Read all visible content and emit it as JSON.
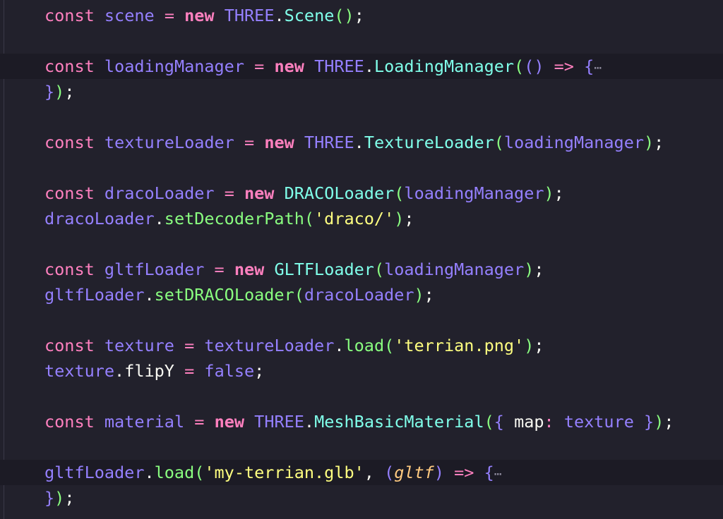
{
  "lines": [
    {
      "tokens": [
        {
          "t": "const",
          "c": "kw"
        },
        {
          "t": " "
        },
        {
          "t": "scene",
          "c": "var"
        },
        {
          "t": " "
        },
        {
          "t": "=",
          "c": "op"
        },
        {
          "t": " "
        },
        {
          "t": "new",
          "c": "new"
        },
        {
          "t": " "
        },
        {
          "t": "THREE",
          "c": "ns"
        },
        {
          "t": ".",
          "c": "plain"
        },
        {
          "t": "Scene",
          "c": "cls"
        },
        {
          "t": "()",
          "c": "brc"
        },
        {
          "t": ";",
          "c": "plain"
        }
      ]
    },
    {
      "tokens": []
    },
    {
      "highlight": true,
      "tokens": [
        {
          "t": "const",
          "c": "kw"
        },
        {
          "t": " "
        },
        {
          "t": "loadingManager",
          "c": "var"
        },
        {
          "t": " "
        },
        {
          "t": "=",
          "c": "op"
        },
        {
          "t": " "
        },
        {
          "t": "new",
          "c": "new"
        },
        {
          "t": " "
        },
        {
          "t": "THREE",
          "c": "ns"
        },
        {
          "t": ".",
          "c": "plain"
        },
        {
          "t": "LoadingManager",
          "c": "cls"
        },
        {
          "t": "(",
          "c": "brc"
        },
        {
          "t": "()",
          "c": "var"
        },
        {
          "t": " "
        },
        {
          "t": "=>",
          "c": "op"
        },
        {
          "t": " "
        },
        {
          "t": "{",
          "c": "var"
        },
        {
          "t": "⋯",
          "c": "fold"
        }
      ]
    },
    {
      "tokens": [
        {
          "t": "}",
          "c": "var"
        },
        {
          "t": ")",
          "c": "brc"
        },
        {
          "t": ";",
          "c": "plain"
        }
      ]
    },
    {
      "tokens": []
    },
    {
      "tokens": [
        {
          "t": "const",
          "c": "kw"
        },
        {
          "t": " "
        },
        {
          "t": "textureLoader",
          "c": "var"
        },
        {
          "t": " "
        },
        {
          "t": "=",
          "c": "op"
        },
        {
          "t": " "
        },
        {
          "t": "new",
          "c": "new"
        },
        {
          "t": " "
        },
        {
          "t": "THREE",
          "c": "ns"
        },
        {
          "t": ".",
          "c": "plain"
        },
        {
          "t": "TextureLoader",
          "c": "cls"
        },
        {
          "t": "(",
          "c": "brc"
        },
        {
          "t": "loadingManager",
          "c": "var"
        },
        {
          "t": ")",
          "c": "brc"
        },
        {
          "t": ";",
          "c": "plain"
        }
      ]
    },
    {
      "tokens": []
    },
    {
      "tokens": [
        {
          "t": "const",
          "c": "kw"
        },
        {
          "t": " "
        },
        {
          "t": "dracoLoader",
          "c": "var"
        },
        {
          "t": " "
        },
        {
          "t": "=",
          "c": "op"
        },
        {
          "t": " "
        },
        {
          "t": "new",
          "c": "new"
        },
        {
          "t": " "
        },
        {
          "t": "DRACOLoader",
          "c": "cls"
        },
        {
          "t": "(",
          "c": "brc"
        },
        {
          "t": "loadingManager",
          "c": "var"
        },
        {
          "t": ")",
          "c": "brc"
        },
        {
          "t": ";",
          "c": "plain"
        }
      ]
    },
    {
      "tokens": [
        {
          "t": "dracoLoader",
          "c": "var"
        },
        {
          "t": ".",
          "c": "plain"
        },
        {
          "t": "setDecoderPath",
          "c": "fn"
        },
        {
          "t": "(",
          "c": "brc"
        },
        {
          "t": "'draco/'",
          "c": "str"
        },
        {
          "t": ")",
          "c": "brc"
        },
        {
          "t": ";",
          "c": "plain"
        }
      ]
    },
    {
      "tokens": []
    },
    {
      "tokens": [
        {
          "t": "const",
          "c": "kw"
        },
        {
          "t": " "
        },
        {
          "t": "gltfLoader",
          "c": "var"
        },
        {
          "t": " "
        },
        {
          "t": "=",
          "c": "op"
        },
        {
          "t": " "
        },
        {
          "t": "new",
          "c": "new"
        },
        {
          "t": " "
        },
        {
          "t": "GLTFLoader",
          "c": "cls"
        },
        {
          "t": "(",
          "c": "brc"
        },
        {
          "t": "loadingManager",
          "c": "var"
        },
        {
          "t": ")",
          "c": "brc"
        },
        {
          "t": ";",
          "c": "plain"
        }
      ]
    },
    {
      "tokens": [
        {
          "t": "gltfLoader",
          "c": "var"
        },
        {
          "t": ".",
          "c": "plain"
        },
        {
          "t": "setDRACOLoader",
          "c": "fn"
        },
        {
          "t": "(",
          "c": "brc"
        },
        {
          "t": "dracoLoader",
          "c": "var"
        },
        {
          "t": ")",
          "c": "brc"
        },
        {
          "t": ";",
          "c": "plain"
        }
      ]
    },
    {
      "tokens": []
    },
    {
      "tokens": [
        {
          "t": "const",
          "c": "kw"
        },
        {
          "t": " "
        },
        {
          "t": "texture",
          "c": "var"
        },
        {
          "t": " "
        },
        {
          "t": "=",
          "c": "op"
        },
        {
          "t": " "
        },
        {
          "t": "textureLoader",
          "c": "var"
        },
        {
          "t": ".",
          "c": "plain"
        },
        {
          "t": "load",
          "c": "fn"
        },
        {
          "t": "(",
          "c": "brc"
        },
        {
          "t": "'terrian.png'",
          "c": "str"
        },
        {
          "t": ")",
          "c": "brc"
        },
        {
          "t": ";",
          "c": "plain"
        }
      ]
    },
    {
      "tokens": [
        {
          "t": "texture",
          "c": "var"
        },
        {
          "t": ".",
          "c": "plain"
        },
        {
          "t": "flipY",
          "c": "plain"
        },
        {
          "t": " "
        },
        {
          "t": "=",
          "c": "op"
        },
        {
          "t": " "
        },
        {
          "t": "false",
          "c": "bool"
        },
        {
          "t": ";",
          "c": "plain"
        }
      ]
    },
    {
      "tokens": []
    },
    {
      "tokens": [
        {
          "t": "const",
          "c": "kw"
        },
        {
          "t": " "
        },
        {
          "t": "material",
          "c": "var"
        },
        {
          "t": " "
        },
        {
          "t": "=",
          "c": "op"
        },
        {
          "t": " "
        },
        {
          "t": "new",
          "c": "new"
        },
        {
          "t": " "
        },
        {
          "t": "THREE",
          "c": "ns"
        },
        {
          "t": ".",
          "c": "plain"
        },
        {
          "t": "MeshBasicMaterial",
          "c": "cls"
        },
        {
          "t": "(",
          "c": "brc"
        },
        {
          "t": "{",
          "c": "var"
        },
        {
          "t": " "
        },
        {
          "t": "map",
          "c": "plain"
        },
        {
          "t": ":",
          "c": "op"
        },
        {
          "t": " "
        },
        {
          "t": "texture",
          "c": "var"
        },
        {
          "t": " "
        },
        {
          "t": "}",
          "c": "var"
        },
        {
          "t": ")",
          "c": "brc"
        },
        {
          "t": ";",
          "c": "plain"
        }
      ]
    },
    {
      "tokens": []
    },
    {
      "highlight": true,
      "tokens": [
        {
          "t": "gltfLoader",
          "c": "var"
        },
        {
          "t": ".",
          "c": "plain"
        },
        {
          "t": "load",
          "c": "fn"
        },
        {
          "t": "(",
          "c": "brc"
        },
        {
          "t": "'my-terrian.glb'",
          "c": "str"
        },
        {
          "t": ",",
          "c": "plain"
        },
        {
          "t": " "
        },
        {
          "t": "(",
          "c": "var"
        },
        {
          "t": "gltf",
          "c": "param"
        },
        {
          "t": ")",
          "c": "var"
        },
        {
          "t": " "
        },
        {
          "t": "=>",
          "c": "op"
        },
        {
          "t": " "
        },
        {
          "t": "{",
          "c": "var"
        },
        {
          "t": "⋯",
          "c": "fold"
        }
      ]
    },
    {
      "tokens": [
        {
          "t": "}",
          "c": "var"
        },
        {
          "t": ")",
          "c": "brc"
        },
        {
          "t": ";",
          "c": "plain"
        }
      ]
    }
  ]
}
